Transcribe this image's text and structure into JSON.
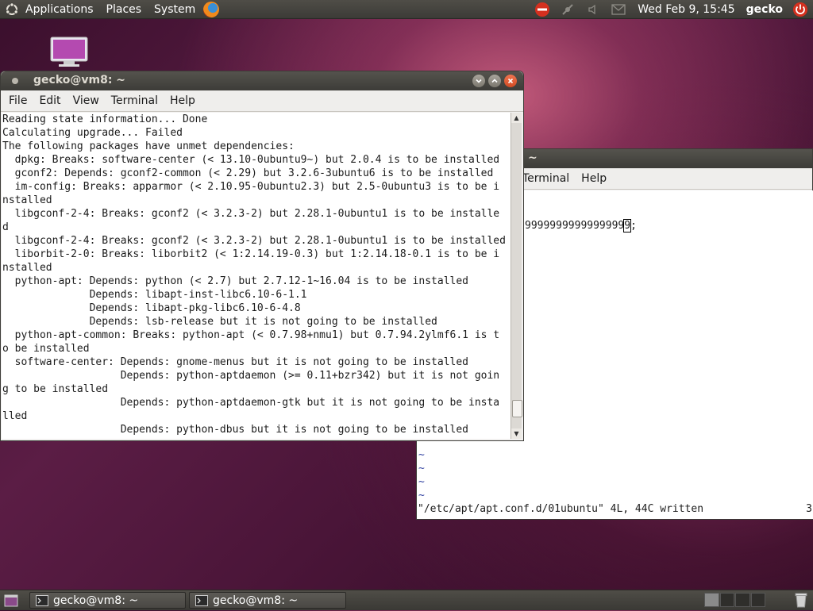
{
  "top_panel": {
    "menus": [
      "Applications",
      "Places",
      "System"
    ],
    "clock": "Wed Feb  9, 15:45",
    "user": "gecko"
  },
  "terminal_front": {
    "title": "gecko@vm8: ~",
    "menu": [
      "File",
      "Edit",
      "View",
      "Terminal",
      "Help"
    ],
    "lines": [
      "Reading state information... Done",
      "Calculating upgrade... Failed",
      "The following packages have unmet dependencies:",
      "  dpkg: Breaks: software-center (< 13.10-0ubuntu9~) but 2.0.4 is to be installed",
      "  gconf2: Depends: gconf2-common (< 2.29) but 3.2.6-3ubuntu6 is to be installed",
      "  im-config: Breaks: apparmor (< 2.10.95-0ubuntu2.3) but 2.5-0ubuntu3 is to be i",
      "nstalled",
      "  libgconf-2-4: Breaks: gconf2 (< 3.2.3-2) but 2.28.1-0ubuntu1 is to be installe",
      "d",
      "  libgconf-2-4: Breaks: gconf2 (< 3.2.3-2) but 2.28.1-0ubuntu1 is to be installed",
      "  liborbit-2-0: Breaks: liborbit2 (< 1:2.14.19-0.3) but 1:2.14.18-0.1 is to be i",
      "nstalled",
      "  python-apt: Depends: python (< 2.7) but 2.7.12-1~16.04 is to be installed",
      "              Depends: libapt-inst-libc6.10-6-1.1",
      "              Depends: libapt-pkg-libc6.10-6-4.8",
      "              Depends: lsb-release but it is not going to be installed",
      "  python-apt-common: Breaks: python-apt (< 0.7.98+nmu1) but 0.7.94.2ylmf6.1 is t",
      "o be installed",
      "  software-center: Depends: gnome-menus but it is not going to be installed",
      "                   Depends: python-aptdaemon (>= 0.11+bzr342) but it is not goin",
      "g to be installed",
      "                   Depends: python-aptdaemon-gtk but it is not going to be insta",
      "lled",
      "                   Depends: python-dbus but it is not going to be installed"
    ]
  },
  "terminal_back": {
    "title": "~",
    "menu": [
      "Terminal",
      "Help"
    ],
    "nines": "9999999999999999",
    "nines_cursor": "9",
    "nines_tail": ";",
    "tildes": [
      "~",
      "~",
      "~",
      "~"
    ],
    "status": "\"/etc/apt/apt.conf.d/01ubuntu\" 4L, 44C written",
    "ruler": "3"
  },
  "bottom_panel": {
    "tasks": [
      "gecko@vm8: ~",
      "gecko@vm8: ~"
    ]
  },
  "colors": {
    "panel": "#3c3b37",
    "close_button": "#e0592f",
    "desktop": "#5b1d45"
  }
}
